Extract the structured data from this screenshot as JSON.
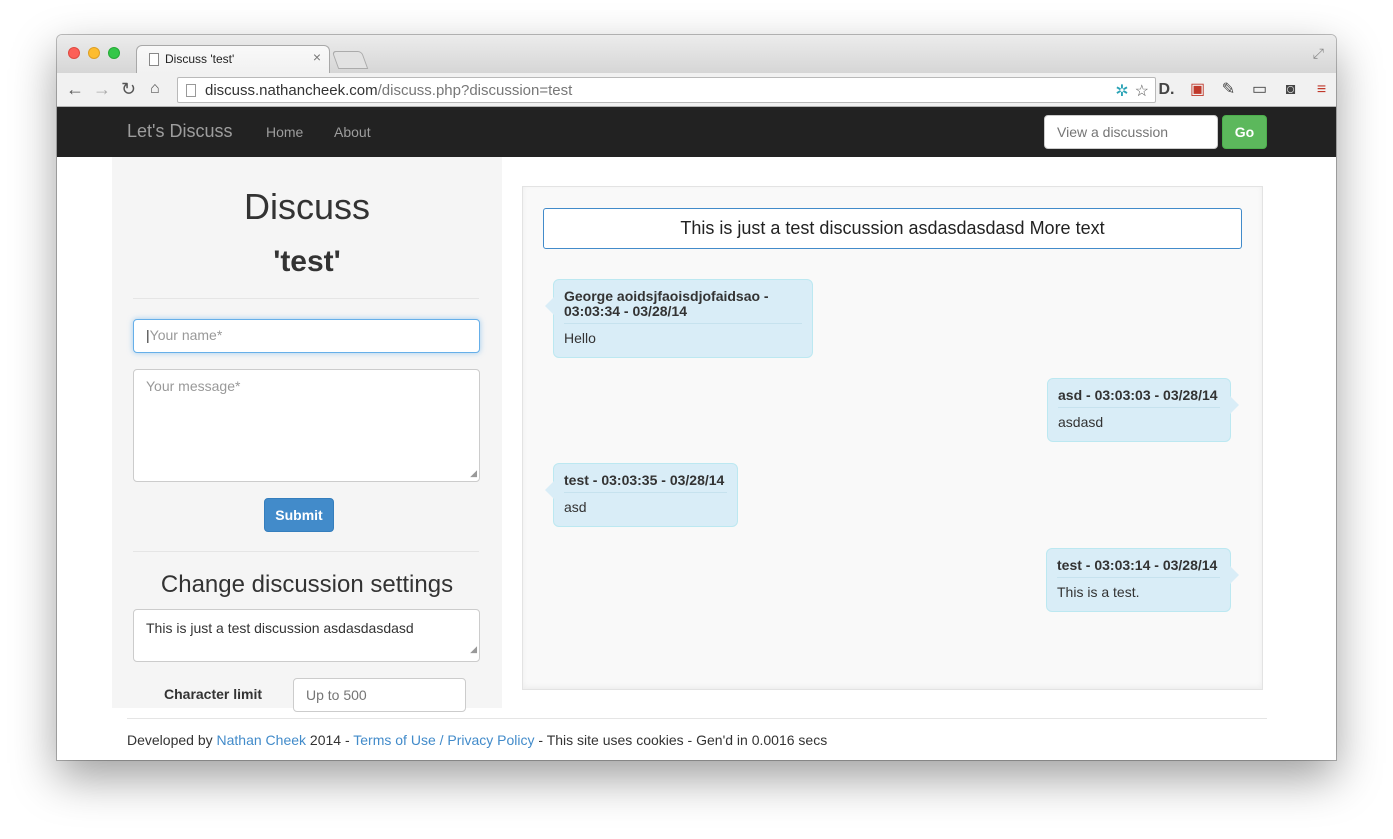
{
  "browser": {
    "tab_title": "Discuss 'test'",
    "tab_close": "×",
    "url_host": "discuss.nathancheek.com",
    "url_path": "/discuss.php?discussion=test"
  },
  "navbar": {
    "brand": "Let's Discuss",
    "links": [
      "Home",
      "About"
    ],
    "search_placeholder": "View a discussion",
    "go_label": "Go"
  },
  "sidebar": {
    "title": "Discuss",
    "subtitle": "'test'",
    "name_placeholder": "Your name*",
    "message_placeholder": "Your message*",
    "submit_label": "Submit",
    "settings_title": "Change discussion settings",
    "settings_text": "This is just a test discussion asdasdasdasd\n\nMore text",
    "char_limit_label": "Character limit",
    "char_limit_placeholder": "Up to 500"
  },
  "discussion": {
    "topic": "This is just a test discussion asdasdasdasd More text",
    "messages": [
      {
        "meta": "George aoidsjfaoisdjofaidsao - 03:03:34 - 03/28/14",
        "text": "Hello",
        "side": "left"
      },
      {
        "meta": "asd - 03:03:03 - 03/28/14",
        "text": "asdasd",
        "side": "right"
      },
      {
        "meta": "test - 03:03:35 - 03/28/14",
        "text": "asd",
        "side": "left"
      },
      {
        "meta": "test - 03:03:14 - 03/28/14",
        "text": "This is a test.",
        "side": "right"
      }
    ]
  },
  "footer": {
    "prefix": "Developed by ",
    "author_link": "Nathan Cheek",
    "year_sep": " 2014 - ",
    "terms_link": "Terms of Use / Privacy Policy",
    "suffix": " - This site uses cookies - Gen'd in 0.0016 secs"
  },
  "colors": {
    "navbar_bg": "#222222",
    "go_button": "#5cb85c",
    "submit_button": "#428bca",
    "bubble_bg": "#d9edf7",
    "link": "#428bca"
  }
}
